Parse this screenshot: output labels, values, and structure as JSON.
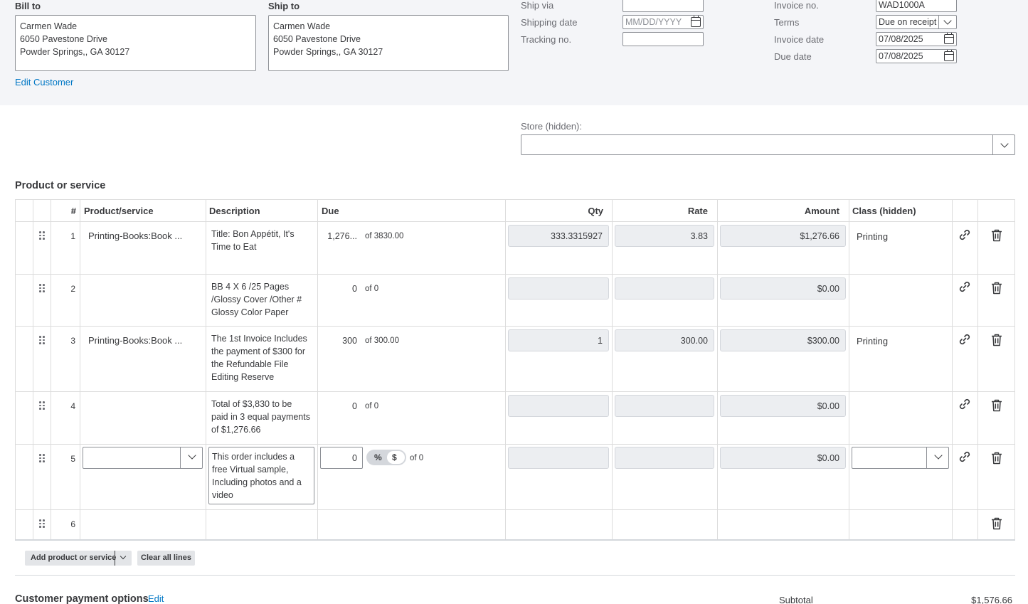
{
  "bill_to": {
    "label": "Bill to",
    "address": "Carmen Wade\n6050 Pavestone Drive\nPowder Springs,, GA  30127"
  },
  "ship_to": {
    "label": "Ship to",
    "address": "Carmen Wade\n6050 Pavestone Drive\nPowder Springs,, GA  30127"
  },
  "edit_customer_label": "Edit Customer",
  "shipping": {
    "ship_via_label": "Ship via",
    "ship_via_value": "",
    "shipping_date_label": "Shipping date",
    "shipping_date_placeholder": "MM/DD/YYYY",
    "tracking_label": "Tracking no.",
    "tracking_value": ""
  },
  "invoice": {
    "number_label": "Invoice no.",
    "number_value": "WAD1000A",
    "terms_label": "Terms",
    "terms_value": "Due on receipt",
    "invoice_date_label": "Invoice date",
    "invoice_date_value": "07/08/2025",
    "due_date_label": "Due date",
    "due_date_value": "07/08/2025"
  },
  "store": {
    "label": "Store (hidden):",
    "value": ""
  },
  "products_section_title": "Product or service",
  "table": {
    "headers": {
      "num": "#",
      "product": "Product/service",
      "description": "Description",
      "due": "Due",
      "qty": "Qty",
      "rate": "Rate",
      "amount": "Amount",
      "class": "Class (hidden)"
    },
    "rows": [
      {
        "num": "1",
        "product": "Printing-Books:Book ...",
        "description": "Title: Bon Appétit, It's\nTime to Eat",
        "due": "1,276...",
        "due_of": "of 3830.00",
        "qty": "333.3315927",
        "rate": "3.83",
        "amount": "$1,276.66",
        "class": "Printing"
      },
      {
        "num": "2",
        "product": "",
        "description": "BB 4 X 6 /25 Pages\n/Glossy Cover /Other #\nGlossy Color Paper",
        "due": "0",
        "due_of": "of 0",
        "qty": "",
        "rate": "",
        "amount": "$0.00",
        "class": ""
      },
      {
        "num": "3",
        "product": "Printing-Books:Book ...",
        "description": "The 1st Invoice Includes\nthe payment of $300 for\nthe Refundable File\nEditing Reserve",
        "due": "300",
        "due_of": "of 300.00",
        "qty": "1",
        "rate": "300.00",
        "amount": "$300.00",
        "class": "Printing"
      },
      {
        "num": "4",
        "product": "",
        "description": "Total of $3,830  to be\npaid in 3 equal payments\nof $1,276.66",
        "due": "0",
        "due_of": "of 0",
        "qty": "",
        "rate": "",
        "amount": "$0.00",
        "class": ""
      },
      {
        "num": "5",
        "product": "",
        "description": "This order includes a\nfree Virtual sample,\nIncluding photos and a\nvideo",
        "due": "0",
        "due_of": "of 0",
        "qty": "",
        "rate": "",
        "amount": "$0.00",
        "class": "",
        "toggle_percent": "%",
        "toggle_dollar": "$"
      },
      {
        "num": "6"
      }
    ]
  },
  "buttons": {
    "add_product": "Add product or service",
    "clear_lines": "Clear all lines"
  },
  "payment_options": {
    "title": "Customer payment options",
    "edit": "Edit"
  },
  "totals": {
    "subtotal_label": "Subtotal",
    "subtotal_value": "$1,576.66"
  },
  "icons": [
    "drag-handle-icon",
    "link-icon",
    "trash-icon",
    "calendar-icon",
    "chevron-down-icon"
  ]
}
